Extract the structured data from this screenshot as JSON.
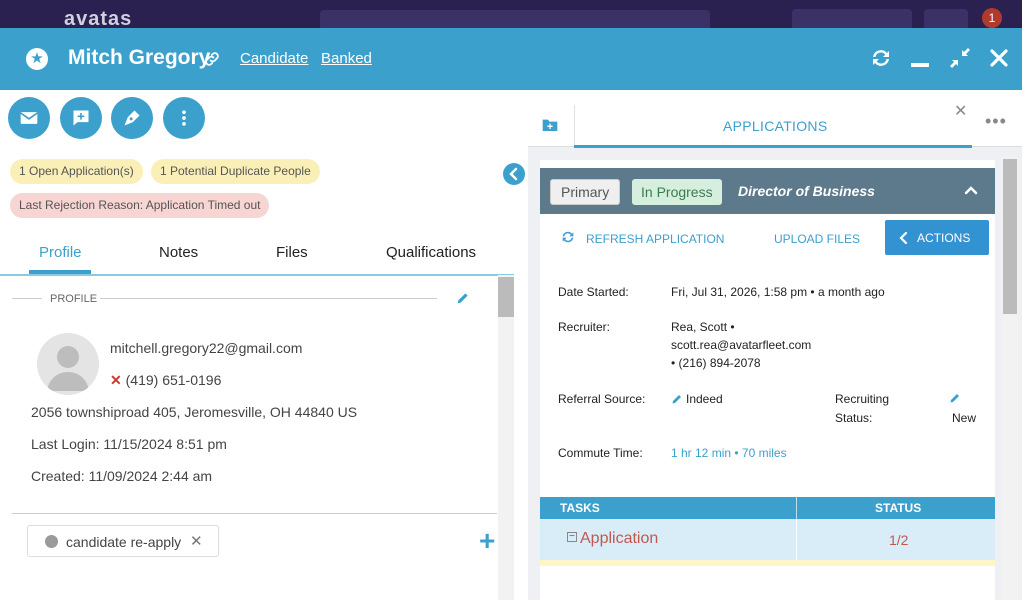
{
  "appbar": {
    "logo": "avatas",
    "notification_count": "1"
  },
  "header": {
    "name": "Mitch Gregory",
    "links": [
      "Candidate",
      "Banked"
    ]
  },
  "chips": {
    "open_apps": "1 Open Application(s)",
    "duplicates": "1 Potential Duplicate People",
    "rejection": "Last Rejection Reason: Application Timed out"
  },
  "tabs": [
    "Profile",
    "Notes",
    "Files",
    "Qualifications"
  ],
  "profile": {
    "section_label": "PROFILE",
    "email": "mitchell.gregory22@gmail.com",
    "phone": "(419) 651-0196",
    "address": "2056 townshiproad 405, Jeromesville, OH 44840 US",
    "last_login": "Last Login: 11/15/2024 8:51 pm",
    "created": "Created: 11/09/2024 2:44 am",
    "tag": "candidate re-apply"
  },
  "applications_panel": {
    "title": "APPLICATIONS",
    "badge_primary": "Primary",
    "badge_status": "In Progress",
    "job_title": "Director of Business",
    "refresh": "REFRESH APPLICATION",
    "upload": "UPLOAD FILES",
    "actions": "ACTIONS",
    "fields": {
      "date_started_label": "Date Started:",
      "date_started": "Fri, Jul 31, 2026, 1:58 pm • a month ago",
      "recruiter_label": "Recruiter:",
      "recruiter_name": "Rea, Scott •",
      "recruiter_email": "scott.rea@avatarfleet.com",
      "recruiter_phone": "• (216) 894-2078",
      "referral_label": "Referral Source:",
      "referral_value": "Indeed",
      "recruiting_status_label_1": "Recruiting",
      "recruiting_status_label_2": "Status:",
      "recruiting_status_value": "New",
      "commute_label": "Commute Time:",
      "commute_value": "1 hr 12 min • 70 miles"
    },
    "tasks": {
      "col_tasks": "TASKS",
      "col_status": "STATUS",
      "rows": [
        {
          "name": "Application",
          "status": "1/2"
        }
      ]
    }
  },
  "colors": {
    "brand": "#3ca0cc",
    "card_header": "#5d7a8d",
    "danger": "#d0352c"
  }
}
